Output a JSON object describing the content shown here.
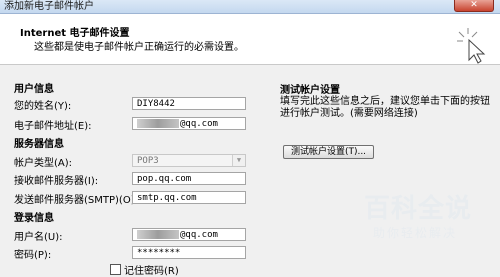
{
  "window": {
    "title": "添加新电子邮件帐户",
    "close_label": "✕"
  },
  "header": {
    "title": "Internet 电子邮件设置",
    "subtitle": "这些都是使电子邮件帐户正确运行的必需设置。"
  },
  "user_info": {
    "section": "用户信息",
    "name_label": "您的姓名(Y):",
    "name_value": "DIY8442",
    "email_label": "电子邮件地址(E):",
    "email_value": "@qq.com"
  },
  "server_info": {
    "section": "服务器信息",
    "account_type_label": "帐户类型(A):",
    "account_type_value": "POP3",
    "incoming_label": "接收邮件服务器(I):",
    "incoming_value": "pop.qq.com",
    "outgoing_label": "发送邮件服务器(SMTP)(O):",
    "outgoing_value": "smtp.qq.com"
  },
  "login_info": {
    "section": "登录信息",
    "user_label": "用户名(U):",
    "user_value": "@qq.com",
    "password_label": "密码(P):",
    "password_value": "********",
    "remember_label": "记住密码(R)"
  },
  "test": {
    "title": "测试帐户设置",
    "desc": "填写完此这些信息之后，建议您单击下面的按钮进行帐户测试。(需要网络连接)",
    "button_label": "测试帐户设置(T)..."
  },
  "watermark": {
    "title": "百科全说",
    "subtitle": "助你轻松解决"
  }
}
